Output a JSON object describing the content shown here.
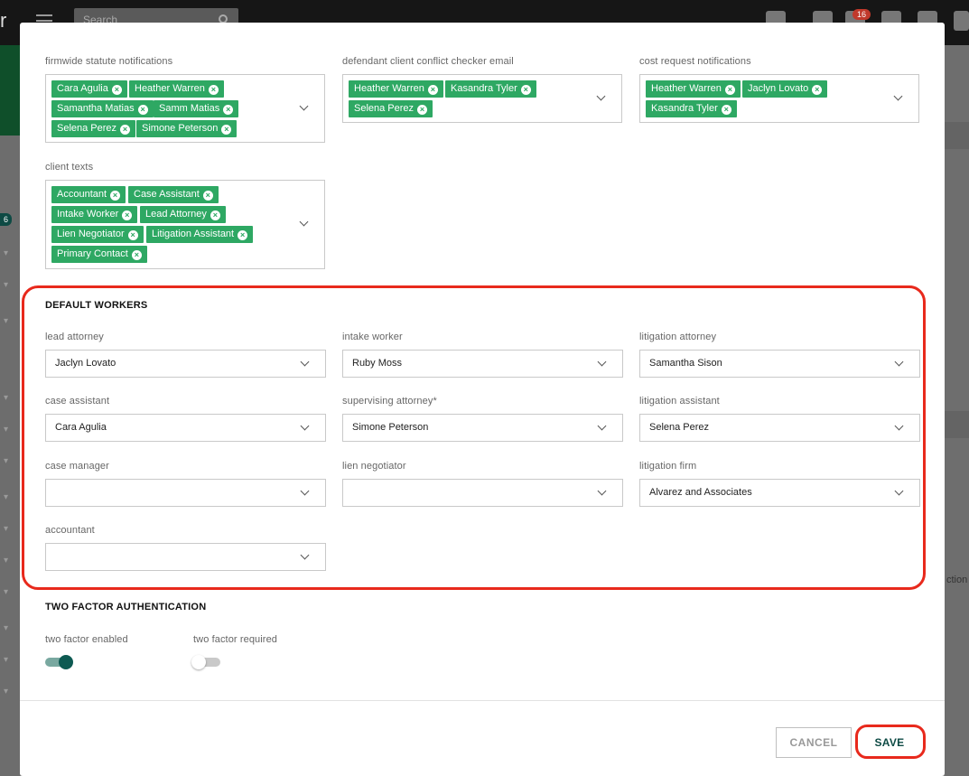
{
  "background": {
    "search_placeholder": "Search",
    "notification_count": "16",
    "sidebar_badge": "6",
    "right_fragment": "ction"
  },
  "notifications": {
    "firmwide": {
      "label": "firmwide statute notifications",
      "chips": [
        "Cara Agulia",
        "Heather Warren",
        "Samantha Matias",
        "Samm Matias",
        "Selena Perez",
        "Simone Peterson"
      ]
    },
    "defendant": {
      "label": "defendant client conflict checker email",
      "chips": [
        "Heather Warren",
        "Kasandra Tyler",
        "Selena Perez"
      ]
    },
    "cost_request": {
      "label": "cost request notifications",
      "chips": [
        "Heather Warren",
        "Jaclyn Lovato",
        "Kasandra Tyler"
      ]
    },
    "client_texts": {
      "label": "client texts",
      "chips": [
        "Accountant",
        "Case Assistant",
        "Intake Worker",
        "Lead Attorney",
        "Lien Negotiator",
        "Litigation Assistant",
        "Primary Contact"
      ]
    }
  },
  "default_workers": {
    "title": "DEFAULT WORKERS",
    "fields": [
      {
        "label": "lead attorney",
        "value": "Jaclyn Lovato"
      },
      {
        "label": "intake worker",
        "value": "Ruby Moss"
      },
      {
        "label": "litigation attorney",
        "value": "Samantha Sison"
      },
      {
        "label": "case assistant",
        "value": "Cara Agulia"
      },
      {
        "label": "supervising attorney*",
        "value": "Simone Peterson"
      },
      {
        "label": "litigation assistant",
        "value": "Selena Perez"
      },
      {
        "label": "case manager",
        "value": ""
      },
      {
        "label": "lien negotiator",
        "value": ""
      },
      {
        "label": "litigation firm",
        "value": "Alvarez and Associates"
      },
      {
        "label": "accountant",
        "value": ""
      }
    ]
  },
  "two_factor": {
    "title": "TWO FACTOR AUTHENTICATION",
    "enabled_label": "two factor enabled",
    "enabled": true,
    "required_label": "two factor required",
    "required": false
  },
  "footer": {
    "cancel_label": "CANCEL",
    "save_label": "SAVE"
  },
  "colors": {
    "chip": "#2ea863",
    "highlight": "#e8291c",
    "brand_teal": "#0d4a44"
  }
}
